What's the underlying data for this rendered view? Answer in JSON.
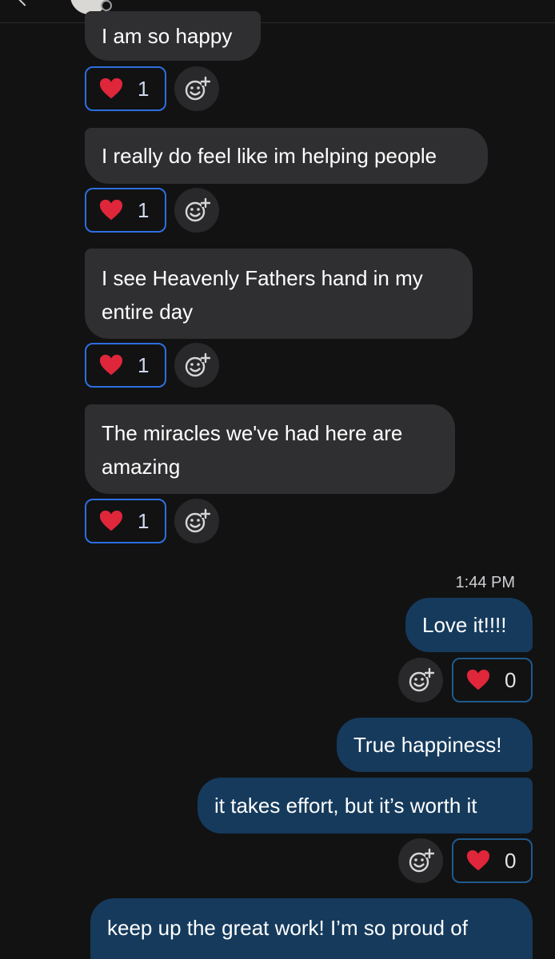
{
  "messages": {
    "incoming": [
      {
        "text": "I am so happy",
        "reaction": {
          "emoji": "heart",
          "count": "1"
        }
      },
      {
        "text": "I really do feel like im helping people",
        "reaction": {
          "emoji": "heart",
          "count": "1"
        }
      },
      {
        "text": "I see Heavenly Fathers hand in my entire day",
        "reaction": {
          "emoji": "heart",
          "count": "1"
        }
      },
      {
        "text": "The miracles we've had here are amazing",
        "reaction": {
          "emoji": "heart",
          "count": "1"
        }
      }
    ],
    "timestamp": "1:44 PM",
    "outgoing": [
      {
        "text": "Love it!!!!",
        "reaction": {
          "emoji": "heart",
          "count": "0"
        }
      },
      {
        "text": "True happiness!"
      },
      {
        "text": "it takes effort, but it’s worth it",
        "reaction": {
          "emoji": "heart",
          "count": "0"
        }
      },
      {
        "text": "keep up the great work! I’m so proud of"
      }
    ]
  },
  "icons": {
    "reaction_heart": "heart-icon",
    "add_reaction": "add-reaction-icon",
    "back": "back-icon"
  },
  "colors": {
    "background": "#121213",
    "incoming_bubble": "#2f2f31",
    "outgoing_bubble": "#153a5c",
    "reaction_border": "#2c6fe0",
    "heart": "#e0263a"
  }
}
